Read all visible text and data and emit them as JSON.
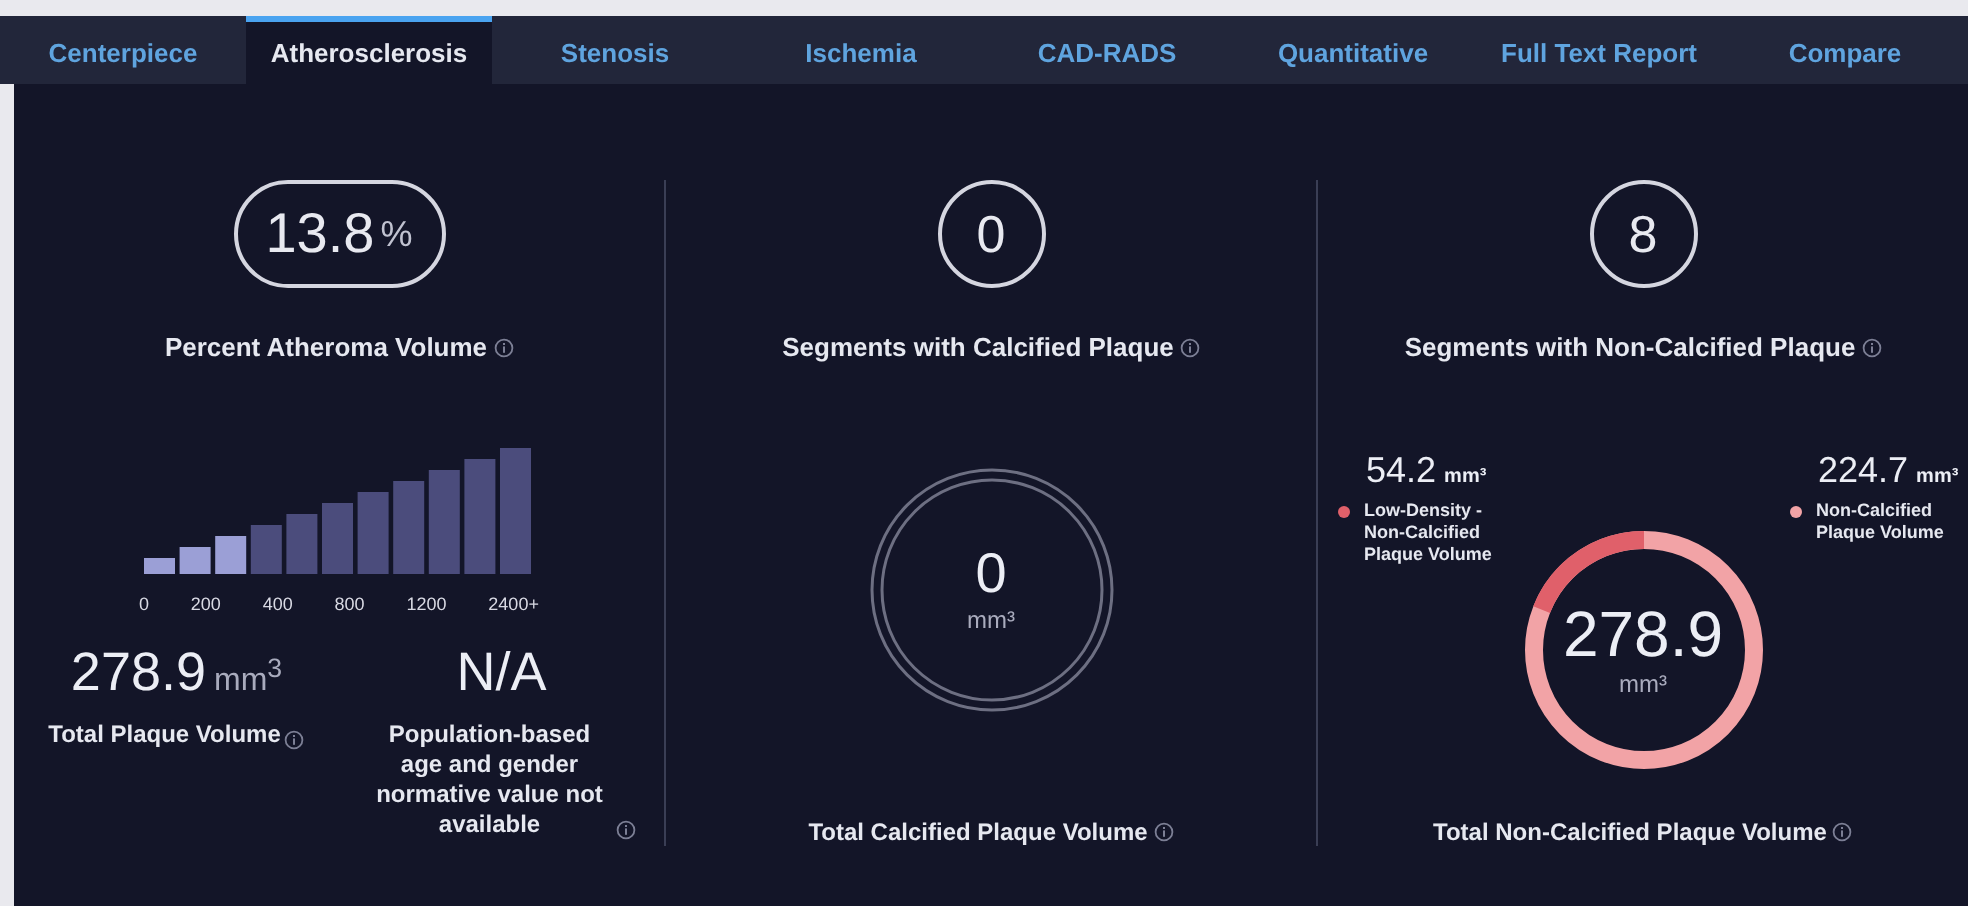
{
  "tabs": [
    {
      "label": "Centerpiece",
      "selected": false
    },
    {
      "label": "Atherosclerosis",
      "selected": true
    },
    {
      "label": "Stenosis",
      "selected": false
    },
    {
      "label": "Ischemia",
      "selected": false
    },
    {
      "label": "CAD-RADS",
      "selected": false
    },
    {
      "label": "Quantitative",
      "selected": false
    },
    {
      "label": "Full Text Report",
      "selected": false
    },
    {
      "label": "Compare",
      "selected": false
    }
  ],
  "atheroma": {
    "value": "13.8",
    "unit": "%",
    "label": "Percent Atheroma Volume"
  },
  "histogram": {
    "tick_labels": [
      "0",
      "200",
      "400",
      "800",
      "1200",
      "2400+"
    ],
    "bars": [
      {
        "selected": true
      },
      {
        "selected": true
      },
      {
        "selected": true
      },
      {
        "selected": false
      },
      {
        "selected": false
      },
      {
        "selected": false
      },
      {
        "selected": false
      },
      {
        "selected": false
      },
      {
        "selected": false
      },
      {
        "selected": false
      },
      {
        "selected": false
      }
    ]
  },
  "total_plaque": {
    "value": "278.9",
    "unit": "mm$^{3}$",
    "label": "Total Plaque Volume"
  },
  "normative": {
    "value": "N/A",
    "label": "Population-based age and gender normative value not available"
  },
  "calcified_segments": {
    "value": "0",
    "label": "Segments with Calcified Plaque"
  },
  "calcified_volume": {
    "value": "0",
    "unit": "mm³",
    "label": "Total Calcified Plaque Volume"
  },
  "noncalcified_segments": {
    "value": "8",
    "label": "Segments with Non-Calcified Plaque"
  },
  "noncalcified_volume": {
    "value": "278.9",
    "unit": "mm³",
    "label": "Total Non-Calcified Plaque Volume",
    "level": 0.19,
    "legend": [
      {
        "value": "54.2",
        "unit": "mm³",
        "label": "Low-Density - Non-Calcified Plaque Volume",
        "color": "#e0606a"
      },
      {
        "value": "224.7",
        "unit": "mm³",
        "label": "Non-Calcified Plaque Volume",
        "color": "#f2a3a6"
      }
    ]
  }
}
